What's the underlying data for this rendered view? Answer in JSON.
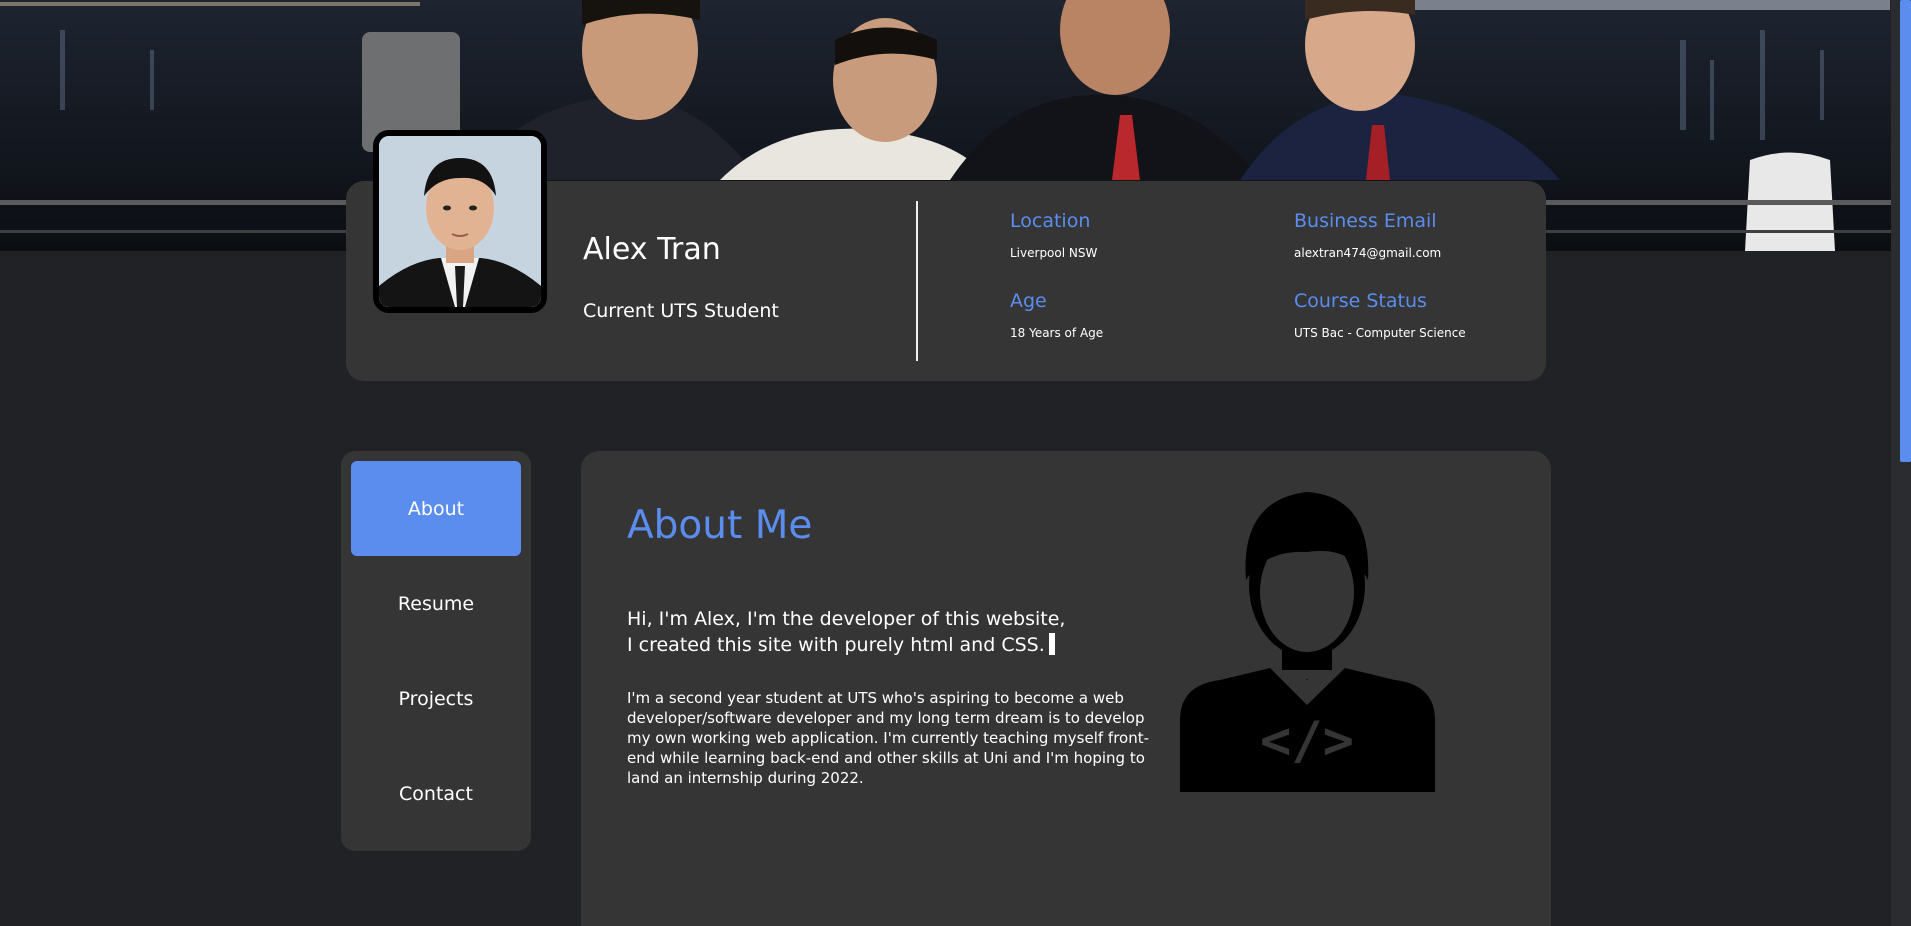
{
  "profile": {
    "name": "Alex Tran",
    "subtitle": "Current UTS Student",
    "info": {
      "location": {
        "label": "Location",
        "value": "Liverpool NSW"
      },
      "email": {
        "label": "Business Email",
        "value": "alextran474@gmail.com"
      },
      "age": {
        "label": "Age",
        "value": "18 Years of Age"
      },
      "course": {
        "label": "Course Status",
        "value": "UTS Bac - Computer Science"
      }
    }
  },
  "nav": {
    "items": [
      {
        "label": "About",
        "active": true
      },
      {
        "label": "Resume",
        "active": false
      },
      {
        "label": "Projects",
        "active": false
      },
      {
        "label": "Contact",
        "active": false
      }
    ]
  },
  "about": {
    "title": "About Me",
    "intro_line1": "Hi, I'm Alex, I'm the developer of this website,",
    "intro_line2": "I created this site with purely html and CSS.",
    "bio": "I'm a second year student at UTS who's aspiring to become a web developer/software developer and my long term dream is to develop my own working web application. I'm currently teaching myself front-end while learning back-end and other skills at Uni and I'm hoping to land an internship during 2022."
  },
  "colors": {
    "accent": "#5b8def",
    "card": "#353535",
    "background": "#202225"
  },
  "icons": {
    "hero": "group-photo-banner",
    "avatar": "profile-photo",
    "illustration": "developer-code-icon"
  }
}
